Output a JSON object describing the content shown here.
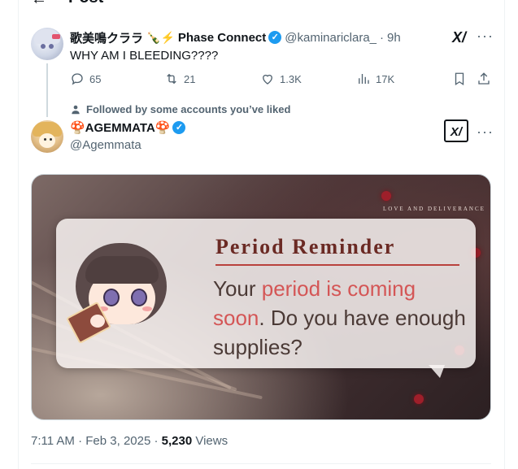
{
  "header": {
    "back_arrow": "←",
    "title": "Post"
  },
  "reply_context": {
    "author": {
      "display_name": "歌美鳴クララ",
      "emojis": "🍾⚡",
      "affiliation": "Phase Connect",
      "handle": "@kaminariclara_",
      "time": "9h"
    },
    "text": "WHY AM I BLEEDING????",
    "metrics": {
      "replies": "65",
      "reposts": "21",
      "likes": "1.3K",
      "views": "17K"
    },
    "grok_label": "X/",
    "more_label": "···"
  },
  "social_context": "Followed by some accounts you’ve liked",
  "main_post": {
    "display_name": "🍄AGEMMATA🍄",
    "handle": "@Agemmata",
    "grok_label": "X/",
    "more_label": "···",
    "image": {
      "title": "Period Reminder",
      "line1_plain": "Your ",
      "line1_highlight": "period is coming",
      "line2_highlight": "soon",
      "line2_plain": ". Do you have enough",
      "line3_plain": "supplies?",
      "corner_text": "LOVE AND DELIVERANCE"
    },
    "timestamp": "7:11 AM · Feb 3, 2025 · ",
    "views_count": "5,230",
    "views_label": " Views"
  },
  "colors": {
    "accent": "#1d9bf0",
    "muted": "#536471",
    "highlight": "#d45656"
  },
  "icons": [
    "reply-icon",
    "repost-icon",
    "like-icon",
    "views-icon",
    "bookmark-icon",
    "share-icon",
    "person-icon",
    "verified-badge-icon"
  ]
}
